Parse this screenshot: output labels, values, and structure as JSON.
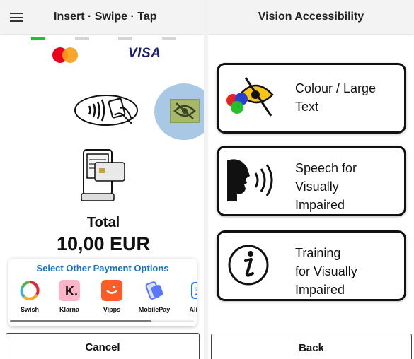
{
  "left_screen": {
    "title": "Insert · Swipe · Tap",
    "card_brands": [
      "Mastercard",
      "VISA"
    ],
    "total_label": "Total",
    "total_amount": "10,00 EUR",
    "payment_options": {
      "title": "Select Other Payment Options",
      "methods": [
        {
          "name": "Swish",
          "color": "#ffffff"
        },
        {
          "name": "Klarna",
          "color": "#ffb3c7"
        },
        {
          "name": "Vipps",
          "color": "#ff5b24"
        },
        {
          "name": "MobilePay",
          "color": "#5a78ff"
        },
        {
          "name": "Alip",
          "color": "#1677ff"
        }
      ]
    },
    "cancel_label": "Cancel",
    "progress_steps": [
      "active",
      "inactive",
      "inactive",
      "inactive",
      "inactive"
    ]
  },
  "right_screen": {
    "title": "Vision Accessibility",
    "options": [
      {
        "label_line1": "Colour / Large",
        "label_line2": "Text",
        "label_line3": "",
        "icon": "colour-eye-icon"
      },
      {
        "label_line1": "Speech for",
        "label_line2": "Visually",
        "label_line3": "Impaired",
        "icon": "speaking-head-icon"
      },
      {
        "label_line1": "Training",
        "label_line2": "for Visually",
        "label_line3": "Impaired",
        "icon": "info-icon"
      }
    ],
    "back_label": "Back"
  },
  "colors": {
    "accent_blue": "#1a72c4",
    "progress_green": "#22c02b",
    "visa_blue": "#1a1f71",
    "mastercard_red": "#eb001b",
    "mastercard_orange": "#f79e1b"
  }
}
